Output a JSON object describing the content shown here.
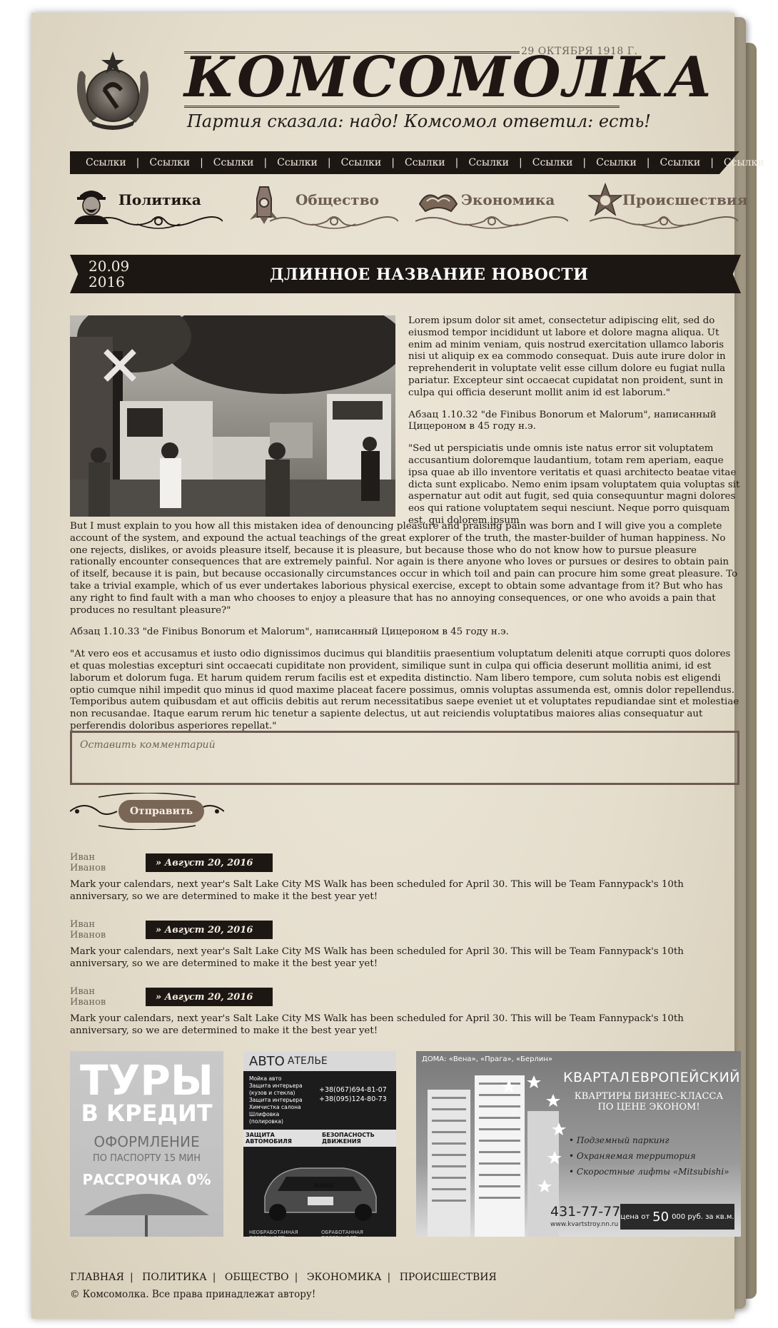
{
  "header": {
    "date": "29 ОКТЯБРЯ 1918 Г.",
    "masthead": "КОМСОМОЛКА",
    "slogan": "Партия сказала: надо! Комсомол ответил: есть!"
  },
  "nav": {
    "links": [
      "Ссылки",
      "Ссылки",
      "Ссылки",
      "Ссылки",
      "Ссылки",
      "Ссылки",
      "Ссылки",
      "Ссылки",
      "Ссылки",
      "Ссылки",
      "Ссылки"
    ],
    "separator": "|"
  },
  "categories": [
    {
      "label": "Политика",
      "icon": "worker-portrait-icon",
      "active": true
    },
    {
      "label": "Общество",
      "icon": "rocket-icon",
      "active": false
    },
    {
      "label": "Экономика",
      "icon": "handshake-icon",
      "active": false
    },
    {
      "label": "Происшествия",
      "icon": "star-emblem-icon",
      "active": false
    }
  ],
  "article": {
    "date_line1": "20.09",
    "date_line2": "2016",
    "title": "ДЛИННОЕ НАЗВАНИЕ НОВОСТИ",
    "p1": "Lorem ipsum dolor sit amet, consectetur adipiscing elit, sed do eiusmod tempor incididunt ut labore et dolore magna aliqua. Ut enim ad minim veniam, quis nostrud exercitation ullamco laboris nisi ut aliquip ex ea commodo consequat. Duis aute irure dolor in reprehenderit in voluptate velit esse cillum dolore eu fugiat nulla pariatur. Excepteur sint occaecat cupidatat non proident, sunt in culpa qui officia deserunt mollit anim id est laborum.\"",
    "p2": "Абзац 1.10.32 \"de Finibus Bonorum et Malorum\", написанный Цицероном в 45 году н.э.",
    "p3": "\"Sed ut perspiciatis unde omnis iste natus error sit voluptatem accusantium doloremque laudantium, totam rem aperiam, eaque ipsa quae ab illo inventore veritatis et quasi architecto beatae vitae dicta sunt explicabo. Nemo enim ipsam voluptatem quia voluptas sit aspernatur aut odit aut fugit, sed quia consequuntur magni dolores eos qui ratione voluptatem sequi nesciunt. Neque porro quisquam est, qui dolorem ipsum",
    "p4": "But I must explain to you how all this mistaken idea of denouncing pleasure and praising pain was born and I will give you a complete account of the system, and expound the actual teachings of the great explorer of the truth, the master-builder of human happiness. No one rejects, dislikes, or avoids pleasure itself, because it is pleasure, but because those who do not know how to pursue pleasure rationally encounter consequences that are extremely painful. Nor again is there anyone who loves or pursues or desires to obtain pain of itself, because it is pain, but because occasionally circumstances occur in which toil and pain can procure him some great pleasure. To take a trivial example, which of us ever undertakes laborious physical exercise, except to obtain some advantage from it? But who has any right to find fault with a man who chooses to enjoy a pleasure that has no annoying consequences, or one who avoids a pain that produces no resultant pleasure?\"",
    "p5": "Абзац 1.10.33 \"de Finibus Bonorum et Malorum\", написанный Цицероном в 45 году н.э.",
    "p6": "\"At vero eos et accusamus et iusto odio dignissimos ducimus qui blanditiis praesentium voluptatum deleniti atque corrupti quos dolores et quas molestias excepturi sint occaecati cupiditate non provident, similique sunt in culpa qui officia deserunt mollitia animi, id est laborum et dolorum fuga. Et harum quidem rerum facilis est et expedita distinctio. Nam libero tempore, cum soluta nobis est eligendi optio cumque nihil impedit quo minus id quod maxime placeat facere possimus, omnis voluptas assumenda est, omnis dolor repellendus. Temporibus autem quibusdam et aut officiis debitis aut rerum necessitatibus saepe eveniet ut et voluptates repudiandae sint et molestiae non recusandae. Itaque earum rerum hic tenetur a sapiente delectus, ut aut reiciendis voluptatibus maiores alias consequatur aut perferendis doloribus asperiores repellat.\""
  },
  "comment_form": {
    "placeholder": "Оставить комментарий",
    "submit_label": "Отправить"
  },
  "comments": [
    {
      "author": "Иван Иванов",
      "date": "» Август 20, 2016",
      "text": "Mark your calendars, next year's Salt Lake City MS Walk has been scheduled for April 30. This will be Team Fannypack's 10th anniversary, so we are determined to make it the best year yet!"
    },
    {
      "author": "Иван Иванов",
      "date": "» Август 20, 2016",
      "text": "Mark your calendars, next year's Salt Lake City MS Walk has been scheduled for April 30. This will be Team Fannypack's 10th anniversary, so we are determined to make it the best year yet!"
    },
    {
      "author": "Иван Иванов",
      "date": "» Август 20, 2016",
      "text": "Mark your calendars, next year's Salt Lake City MS Walk has been scheduled for April 30. This will be Team Fannypack's 10th anniversary, so we are determined to make it the best year yet!"
    }
  ],
  "ads": {
    "tours": {
      "line1": "ТУРЫ",
      "line2": "В КРЕДИТ",
      "line3": "ОФОРМЛЕНИЕ",
      "line4": "ПО ПАСПОРТУ 15 МИН",
      "line5": "РАССРОЧКА 0%"
    },
    "auto": {
      "brand1": "АВТО",
      "brand2": "АТЕЛЬЕ",
      "services": [
        "Мойка авто",
        "Защита интерьера (кузов и стекла)",
        "Защита интерьера",
        "Химчистка салона",
        "Шлифовка (полировка)"
      ],
      "phone1": "+38(067)694-81-07",
      "phone2": "+38(095)124-80-73",
      "tag1": "ЗАЩИТА АВТОМОБИЛЯ",
      "tag2": "БЕЗОПАСНОСТЬ ДВИЖЕНИЯ",
      "bottom1": "НЕОБРАБОТАННАЯ ПОВЕРХНОСТЬ",
      "bottom2": "ОБРАБОТАННАЯ ПОВЕРХНОСТЬ",
      "plate": "NANO"
    },
    "realty": {
      "top": "ДОМА: «Вена», «Прага», «Берлин»",
      "brand_a": "КВАРТАЛ",
      "brand_b": "ЕВРОПЕЙСКИЙ",
      "tag1": "КВАРТИРЫ БИЗНЕС-КЛАССА",
      "tag2": "ПО ЦЕНЕ ЭКОНОМ!",
      "features": [
        "Подземный паркинг",
        "Охраняемая территория",
        "Скоростные лифты «Mitsubishi»"
      ],
      "phone": "431-77-77",
      "site": "www.kvartstroy.nn.ru",
      "price_prefix": "цена от",
      "price": "50",
      "price_suffix": "000 руб. за кв.м."
    }
  },
  "footer": {
    "links": [
      "ГЛАВНАЯ",
      "ПОЛИТИКА",
      "ОБЩЕСТВО",
      "ЭКОНОМИКА",
      "ПРОИСШЕСТВИЯ"
    ],
    "separator": "|",
    "copyright": "© Комсомолка. Все права принадлежат автору!"
  }
}
